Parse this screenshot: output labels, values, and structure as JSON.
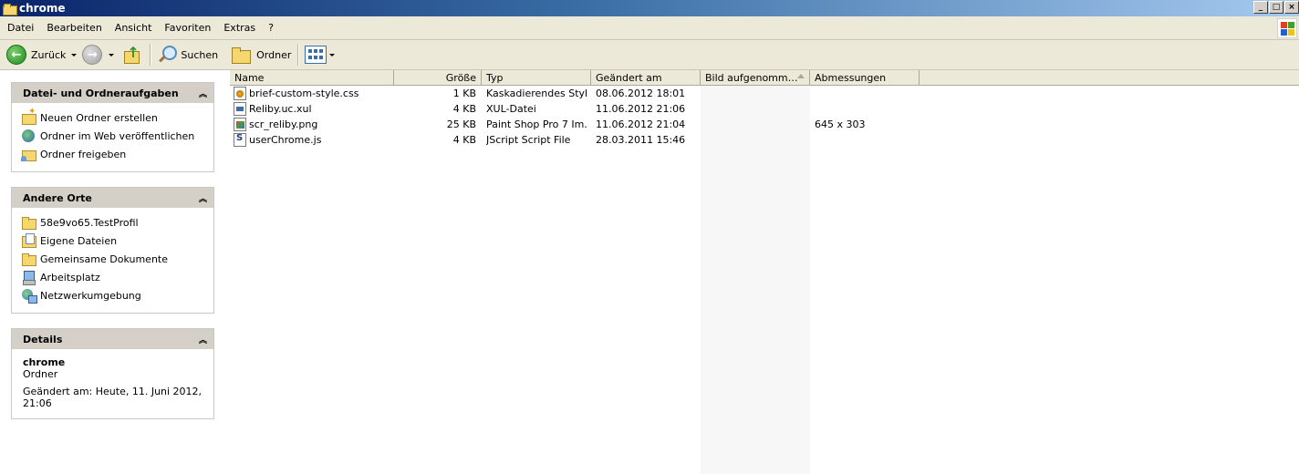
{
  "window": {
    "title": "chrome",
    "min_glyph": "_",
    "max_glyph": "□",
    "close_glyph": "×"
  },
  "menu": [
    "Datei",
    "Bearbeiten",
    "Ansicht",
    "Favoriten",
    "Extras",
    "?"
  ],
  "toolbar": {
    "back_label": "Zurück",
    "back_glyph": "←",
    "forward_glyph": "→",
    "search_label": "Suchen",
    "folders_label": "Ordner"
  },
  "tasks_panel": {
    "title": "Datei- und Ordneraufgaben",
    "collapse_glyph": "︽",
    "items": [
      {
        "label": "Neuen Ordner erstellen",
        "icon": "new-folder-icon"
      },
      {
        "label": "Ordner im Web veröffentlichen",
        "icon": "globe-icon"
      },
      {
        "label": "Ordner freigeben",
        "icon": "share-folder-icon"
      }
    ]
  },
  "places_panel": {
    "title": "Andere Orte",
    "collapse_glyph": "︽",
    "items": [
      {
        "label": "58e9vo65.TestProfil",
        "icon": "folder-icon"
      },
      {
        "label": "Eigene Dateien",
        "icon": "my-documents-icon"
      },
      {
        "label": "Gemeinsame Dokumente",
        "icon": "folder-icon"
      },
      {
        "label": "Arbeitsplatz",
        "icon": "computer-icon"
      },
      {
        "label": "Netzwerkumgebung",
        "icon": "network-icon"
      }
    ]
  },
  "details_panel": {
    "title": "Details",
    "collapse_glyph": "︽",
    "name": "chrome",
    "type": "Ordner",
    "modified_line1": "Geändert am: Heute, 11. Juni 2012,",
    "modified_line2": "21:06"
  },
  "columns": {
    "name": "Name",
    "size": "Größe",
    "type": "Typ",
    "modified": "Geändert am",
    "taken": "Bild aufgenomm…",
    "dimensions": "Abmessungen"
  },
  "files": [
    {
      "name": "brief-custom-style.css",
      "size": "1 KB",
      "type": "Kaskadierendes Styl…",
      "modified": "08.06.2012 18:01",
      "dimensions": "",
      "icon": "css-file-icon"
    },
    {
      "name": "Reliby.uc.xul",
      "size": "4 KB",
      "type": "XUL-Datei",
      "modified": "11.06.2012 21:06",
      "dimensions": "",
      "icon": "xul-file-icon"
    },
    {
      "name": "scr_reliby.png",
      "size": "25 KB",
      "type": "Paint Shop Pro 7 Im…",
      "modified": "11.06.2012 21:04",
      "dimensions": "645 x 303",
      "icon": "png-file-icon"
    },
    {
      "name": "userChrome.js",
      "size": "4 KB",
      "type": "JScript Script File",
      "modified": "28.03.2011 15:46",
      "dimensions": "",
      "icon": "js-file-icon"
    }
  ],
  "colors": {
    "titlebar_start": "#0a246a",
    "titlebar_end": "#a6caf0",
    "panel_header": "#d4d0c8",
    "sorted_column": "#f7f7f7"
  }
}
